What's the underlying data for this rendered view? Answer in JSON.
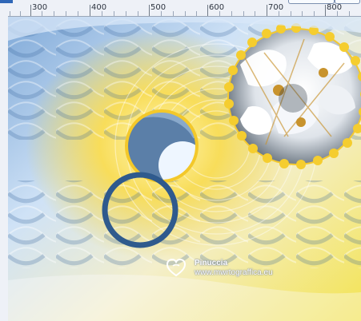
{
  "ruler": {
    "labels": [
      "300",
      "400",
      "500",
      "600",
      "700",
      "800"
    ]
  },
  "watermark": {
    "brand": "Pinuccia",
    "site": "www.mwrtograffica.eu",
    "icon": "heart-shield-icon"
  },
  "colors": {
    "ruler_bg": "#eef1f7",
    "accent_blue": "#2f5a8d",
    "gold": "#f2cb2d",
    "yellow": "#f4e15d",
    "sky": "#8fb4dc"
  }
}
